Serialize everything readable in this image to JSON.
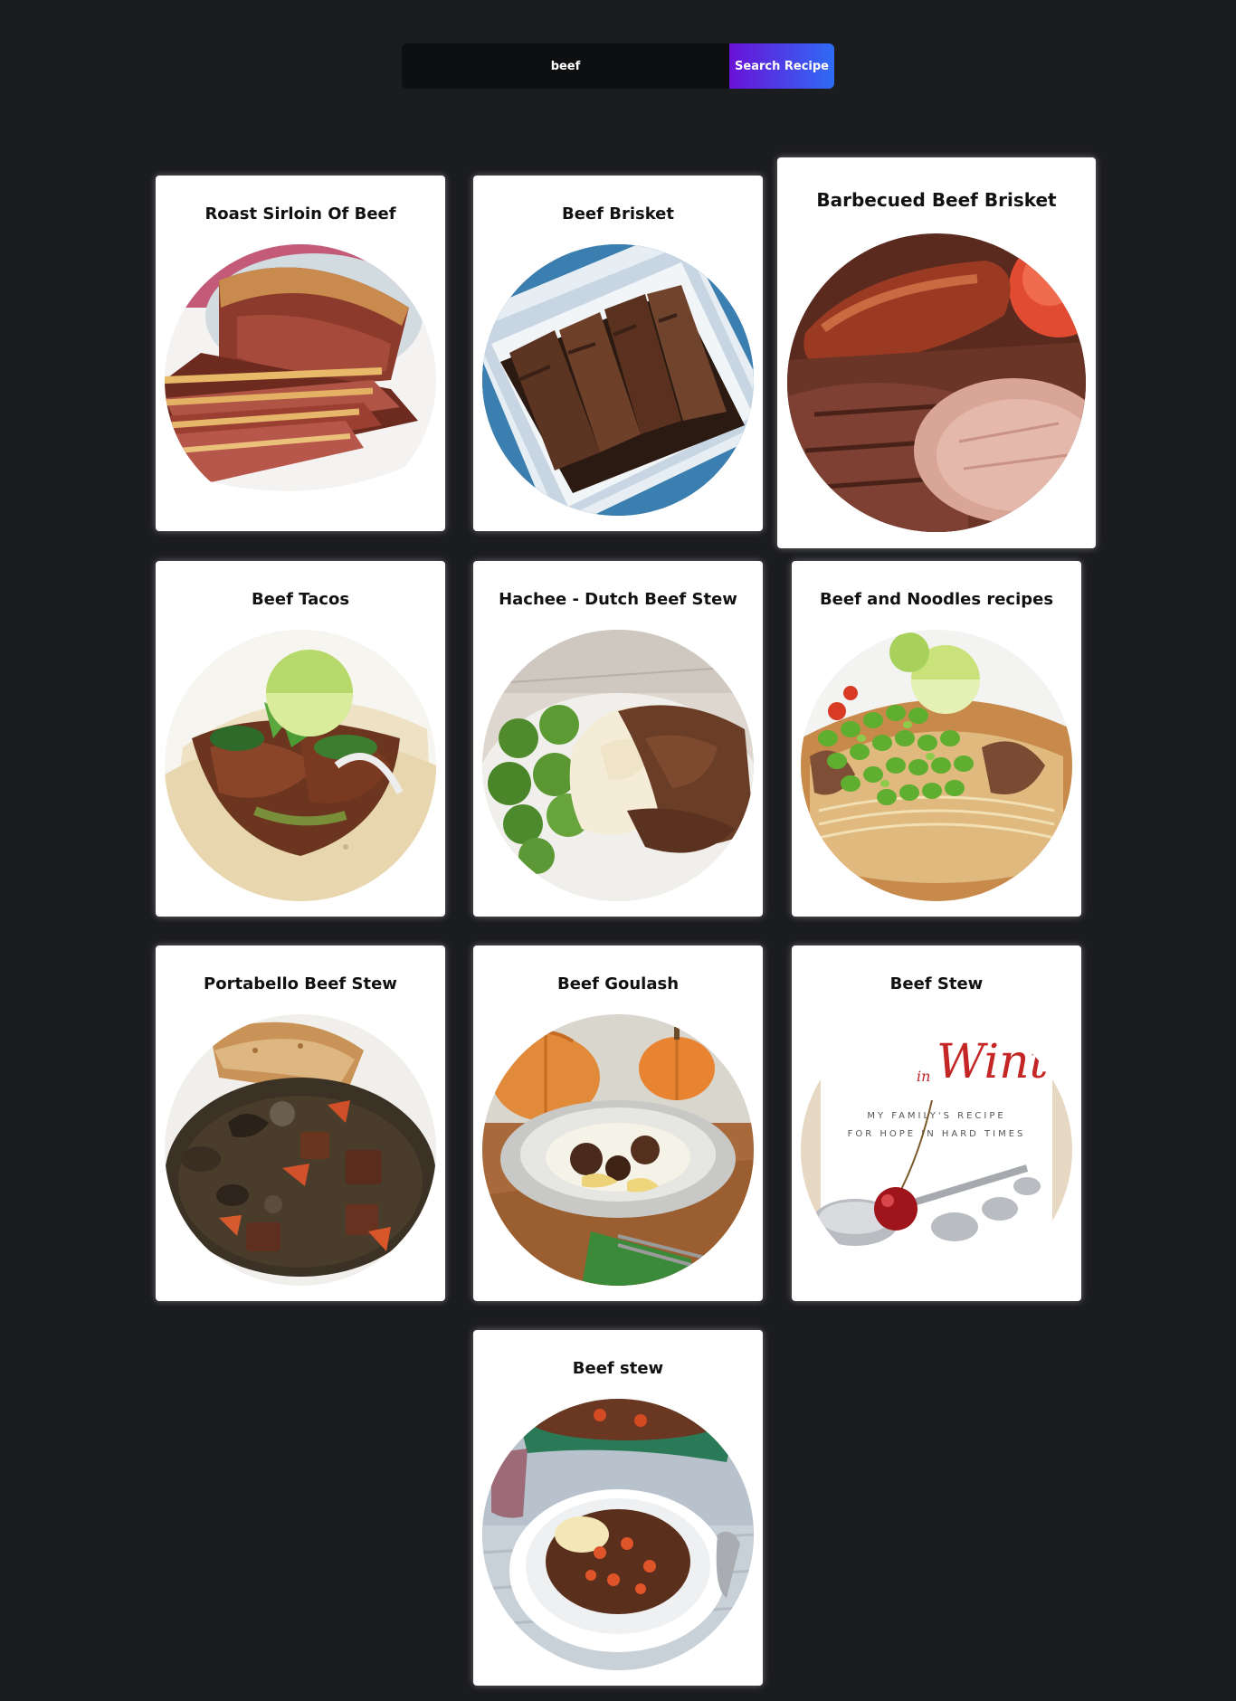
{
  "search": {
    "value": "beef",
    "button_label": "Search Recipe"
  },
  "recipes": [
    {
      "title": "Roast Sirloin Of Beef"
    },
    {
      "title": "Beef Brisket"
    },
    {
      "title": "Barbecued Beef Brisket"
    },
    {
      "title": "Beef Tacos"
    },
    {
      "title": "Hachee - Dutch Beef Stew"
    },
    {
      "title": "Beef and Noodles recipes"
    },
    {
      "title": "Portabello Beef Stew"
    },
    {
      "title": "Beef Goulash"
    },
    {
      "title": "Beef Stew"
    },
    {
      "title": "Beef stew"
    }
  ],
  "book_cover": {
    "script_word": "Winter",
    "small_word": "in",
    "line1": "MY FAMILY'S RECIPE",
    "line2": "FOR HOPE IN HARD TIMES"
  },
  "colors": {
    "background": "#1b1c20",
    "input_bg": "#0e0f11",
    "button_gradient_start": "#6a12d8",
    "button_gradient_end": "#2e6bf4",
    "card_bg": "#ffffff"
  }
}
